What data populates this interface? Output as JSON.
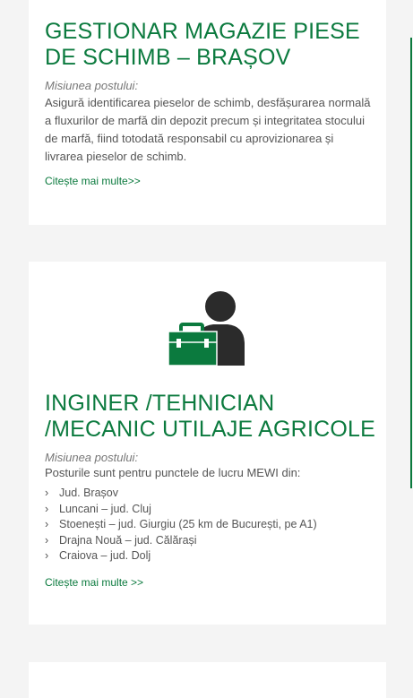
{
  "jobs": [
    {
      "title_line1": "GESTIONAR MAGAZIE PIESE",
      "title_line2": "DE SCHIMB – BRAȘOV",
      "mission_label": "Misiunea postului:",
      "mission_text": "Asigură identificarea pieselor de schimb, desfășurarea normală a fluxurilor de marfă din depozit precum și integritatea stocului de marfă, fiind totodată responsabil cu aprovizionarea și livrarea pieselor de schimb.",
      "read_more": "Citește mai multe>>"
    },
    {
      "icon": "worker-briefcase-icon",
      "title_line1": "INGINER /TEHNICIAN",
      "title_line2": "/MECANIC UTILAJE AGRICOLE",
      "mission_label": "Misiunea postului:",
      "mission_text": "Posturile sunt pentru punctele de lucru MEWI din:",
      "locations": [
        "Jud. Brașov",
        "Luncani – jud. Cluj",
        "Stoenești – jud. Giurgiu (25 km de București, pe A1)",
        "Drajna Nouă – jud. Călărași",
        "Craiova – jud. Dolj"
      ],
      "read_more": "Citește mai multe >>"
    }
  ],
  "colors": {
    "accent": "#0b7a3e",
    "icon_dark": "#2b2b2b",
    "background": "#f4f4f4"
  }
}
